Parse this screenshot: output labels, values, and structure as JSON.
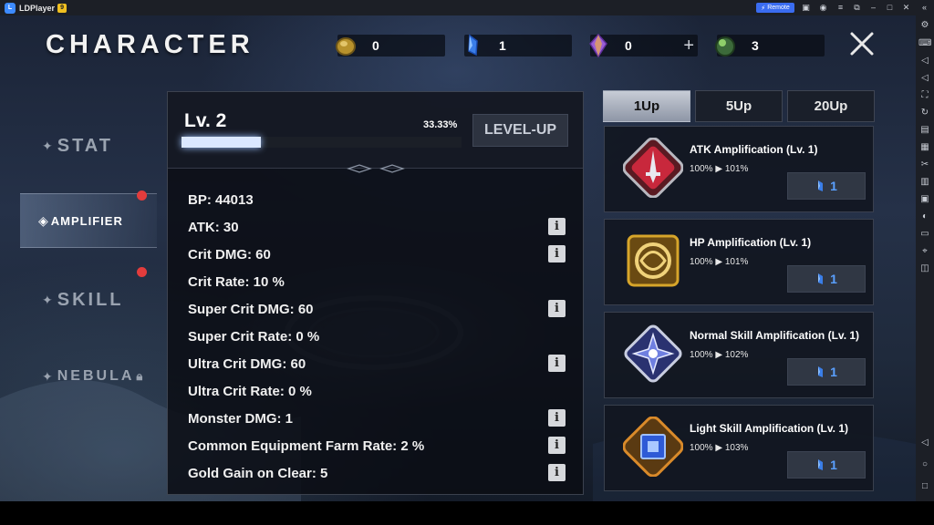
{
  "emulator": {
    "app_name": "LDPlayer",
    "badge": "9",
    "remote_label": "Remote"
  },
  "page": {
    "title": "CHARACTER"
  },
  "resources": [
    {
      "icon": "gold-coin-icon",
      "value": "0",
      "has_plus": false
    },
    {
      "icon": "blue-crystal-icon",
      "value": "1",
      "has_plus": false
    },
    {
      "icon": "purple-gem-icon",
      "value": "0",
      "has_plus": true,
      "plus": "+"
    },
    {
      "icon": "green-orb-icon",
      "value": "3",
      "has_plus": false
    }
  ],
  "tabs": [
    {
      "label": "STAT",
      "active": false,
      "notification": false
    },
    {
      "label": "AMPLIFIER",
      "active": true,
      "notification": true
    },
    {
      "label": "SKILL",
      "active": false,
      "notification": true
    },
    {
      "label": "NEBULA",
      "active": false,
      "notification": false,
      "locked": true
    }
  ],
  "level": {
    "label": "Lv. 2",
    "progress_pct_text": "33.33%",
    "progress": 0.3333,
    "levelup_label": "LEVEL-UP"
  },
  "stats": [
    {
      "text": "BP: 44013",
      "info": false
    },
    {
      "text": "ATK: 30",
      "info": true
    },
    {
      "text": "Crit DMG: 60",
      "info": true
    },
    {
      "text": "Crit Rate: 10 %",
      "info": false
    },
    {
      "text": "Super Crit DMG: 60",
      "info": true
    },
    {
      "text": "Super Crit Rate: 0 %",
      "info": false
    },
    {
      "text": "Ultra Crit DMG: 60",
      "info": true
    },
    {
      "text": "Ultra Crit Rate: 0 %",
      "info": false
    },
    {
      "text": "Monster DMG: 1",
      "info": true
    },
    {
      "text": "Common Equipment Farm Rate: 2 %",
      "info": true
    },
    {
      "text": "Gold Gain on Clear: 5",
      "info": true
    }
  ],
  "info_glyph": "i",
  "upgrade_tabs": [
    {
      "label": "1Up",
      "active": true
    },
    {
      "label": "5Up",
      "active": false
    },
    {
      "label": "20Up",
      "active": false
    }
  ],
  "amplifications": [
    {
      "name": "ATK Amplification (Lv. 1)",
      "change": "100% ▶ 101%",
      "cost": "1",
      "icon": "atk-sword-icon",
      "color": "#c8283c"
    },
    {
      "name": "HP Amplification (Lv. 1)",
      "change": "100% ▶ 101%",
      "cost": "1",
      "icon": "hp-knot-icon",
      "color": "#d7a52a"
    },
    {
      "name": "Normal Skill Amplification (Lv. 1)",
      "change": "100% ▶ 102%",
      "cost": "1",
      "icon": "normal-skill-star-icon",
      "color": "#6f7fe0"
    },
    {
      "name": "Light Skill Amplification (Lv. 1)",
      "change": "100% ▶ 103%",
      "cost": "1",
      "icon": "light-skill-gem-icon",
      "color": "#d98a2a"
    }
  ]
}
